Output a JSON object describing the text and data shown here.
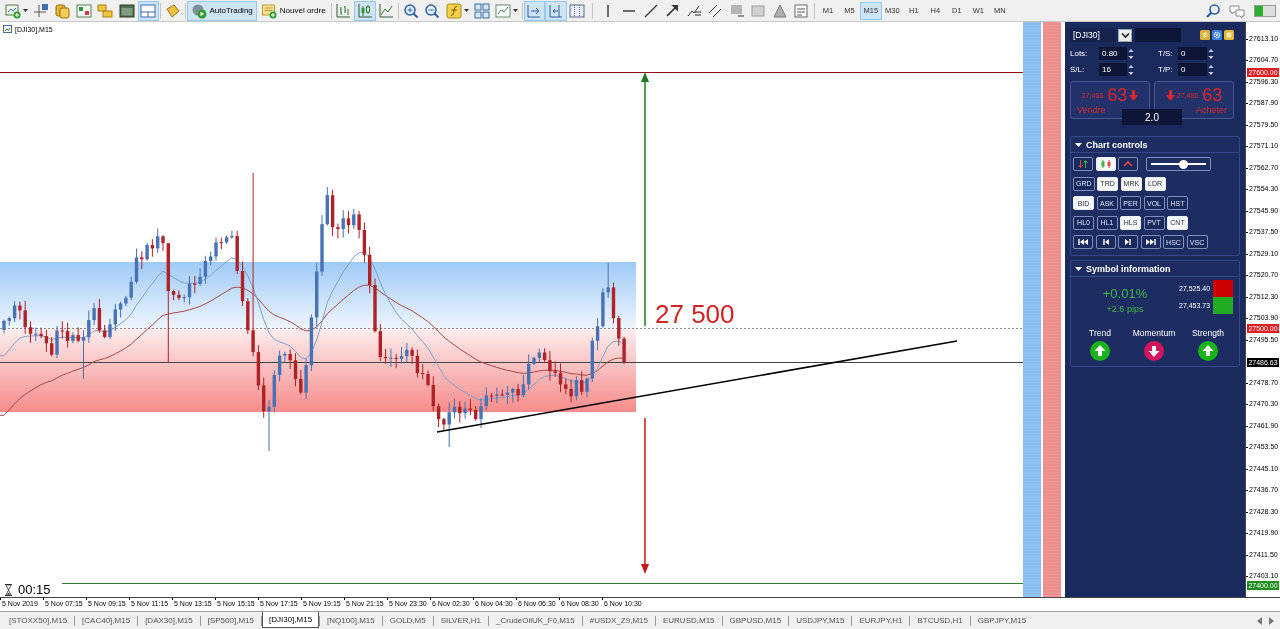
{
  "toolbar": {
    "groups": [
      [
        {
          "kind": "icon",
          "selected": false
        },
        {
          "kind": "icon",
          "selected": false
        },
        {
          "kind": "icon",
          "selected": false
        },
        {
          "kind": "icon",
          "selected": false
        },
        {
          "kind": "icon",
          "selected": false
        },
        {
          "kind": "icon",
          "selected": false
        },
        {
          "kind": "icon",
          "selected": true
        }
      ],
      [
        {
          "kind": "icon",
          "selected": false
        }
      ],
      [
        {
          "kind": "button",
          "label": "AutoTrading",
          "selected": true
        },
        {
          "kind": "button",
          "label": "Nouvel ordre",
          "selected": false
        }
      ],
      [
        {
          "kind": "icon",
          "selected": false
        },
        {
          "kind": "icon",
          "selected": true
        },
        {
          "kind": "icon",
          "selected": false
        }
      ],
      [
        {
          "kind": "icon",
          "selected": false
        },
        {
          "kind": "icon",
          "selected": false
        },
        {
          "kind": "icon",
          "selected": false
        },
        {
          "kind": "icon",
          "selected": false
        },
        {
          "kind": "icon",
          "selected": false
        }
      ],
      [
        {
          "kind": "icon",
          "selected": true
        },
        {
          "kind": "icon",
          "selected": true
        },
        {
          "kind": "icon",
          "selected": false
        }
      ],
      [
        {
          "kind": "icon",
          "selected": false
        },
        {
          "kind": "icon",
          "selected": false
        },
        {
          "kind": "icon",
          "selected": false
        },
        {
          "kind": "icon",
          "selected": false
        },
        {
          "kind": "icon",
          "selected": false
        },
        {
          "kind": "icon",
          "selected": false
        },
        {
          "kind": "icon",
          "selected": false
        },
        {
          "kind": "icon",
          "selected": false
        },
        {
          "kind": "icon",
          "selected": false
        },
        {
          "kind": "icon",
          "selected": false
        }
      ],
      [
        {
          "kind": "timeframe",
          "label": "M1",
          "selected": false
        },
        {
          "kind": "timeframe",
          "label": "M5",
          "selected": false
        },
        {
          "kind": "timeframe",
          "label": "M15",
          "selected": true
        },
        {
          "kind": "timeframe",
          "label": "M30",
          "selected": false
        },
        {
          "kind": "timeframe",
          "label": "H1",
          "selected": false
        },
        {
          "kind": "timeframe",
          "label": "H4",
          "selected": false
        },
        {
          "kind": "timeframe",
          "label": "D1",
          "selected": false
        },
        {
          "kind": "timeframe",
          "label": "W1",
          "selected": false
        },
        {
          "kind": "timeframe",
          "label": "MN",
          "selected": false
        }
      ]
    ]
  },
  "chart": {
    "title": "[DJI30],M15",
    "annotation": "27 500",
    "timer": "00:15",
    "strips": [
      {
        "color": "#90c4f4"
      },
      {
        "color": "#f39494"
      }
    ],
    "price_axis": {
      "ticks": [
        "27613.10",
        "27604.70",
        "27596.30",
        "27587.90",
        "27579.50",
        "27571.10",
        "27562.70",
        "27554.30",
        "27545.90",
        "27537.50",
        "27529.10",
        "27520.70",
        "27512.30",
        "27503.90",
        "27495.50",
        "27478.70",
        "27470.30",
        "27461.90",
        "27453.50",
        "27445.10",
        "27436.70",
        "27428.30",
        "27419.90",
        "27411.50",
        "27403.10"
      ],
      "tags": [
        {
          "text": "27600.00",
          "color": "#e01e1e"
        },
        {
          "text": "27500.00",
          "color": "#e01e1e"
        },
        {
          "text": "27486.63",
          "color": "#000000"
        },
        {
          "text": "27400.00",
          "color": "#1e8c1e"
        }
      ]
    },
    "time_axis": {
      "labels": [
        "5 Nov 2019",
        "5 Nov 07:15",
        "5 Nov 09:15",
        "5 Nov 11:15",
        "5 Nov 13:15",
        "5 Nov 15:15",
        "5 Nov 17:15",
        "5 Nov 19:15",
        "5 Nov 21:15",
        "5 Nov 23:30",
        "6 Nov 02:30",
        "6 Nov 04:30",
        "6 Nov 06:30",
        "6 Nov 08:30",
        "6 Nov 10:30"
      ]
    }
  },
  "panel": {
    "symbol": "[DJI30]",
    "rows": [
      [
        {
          "label": "Lots:",
          "value": "0.80"
        },
        {
          "label": "T/S:",
          "value": "0"
        }
      ],
      [
        {
          "label": "S/L:",
          "value": "16"
        },
        {
          "label": "T/P:",
          "value": "0"
        }
      ]
    ],
    "sell": {
      "price": "27,486.",
      "pips": "63",
      "label": "Vendre",
      "falling": true
    },
    "buy": {
      "price": "27,486.",
      "pips": "63",
      "label": "Acheter",
      "falling": true
    },
    "volume": "2.0",
    "chart_controls": {
      "title": "Chart controls",
      "rows": [
        [
          {
            "kind": "icon",
            "selected": false
          },
          {
            "kind": "icon",
            "selected": true
          },
          {
            "kind": "icon",
            "selected": false
          },
          {
            "kind": "slider",
            "level": 0.6
          }
        ],
        [
          {
            "kind": "text",
            "label": "GRD",
            "selected": false
          },
          {
            "kind": "text",
            "label": "TRD",
            "selected": true
          },
          {
            "kind": "text",
            "label": "MRK",
            "selected": true
          },
          {
            "kind": "text",
            "label": "LDR",
            "selected": true
          }
        ],
        [
          {
            "kind": "text",
            "label": "BID",
            "selected": true
          },
          {
            "kind": "text",
            "label": "ASK",
            "selected": false
          },
          {
            "kind": "text",
            "label": "PER",
            "selected": false
          },
          {
            "kind": "text",
            "label": "VOL",
            "selected": false
          },
          {
            "kind": "text",
            "label": "HST",
            "selected": false
          }
        ],
        [
          {
            "kind": "text",
            "label": "HL0",
            "selected": false
          },
          {
            "kind": "text",
            "label": "HL1",
            "selected": false
          },
          {
            "kind": "text",
            "label": "HLS",
            "selected": true
          },
          {
            "kind": "text",
            "label": "PVT",
            "selected": false
          },
          {
            "kind": "text",
            "label": "CNT",
            "selected": true
          }
        ],
        [
          {
            "kind": "icon",
            "selected": false
          },
          {
            "kind": "icon",
            "selected": false
          },
          {
            "kind": "icon",
            "selected": false
          },
          {
            "kind": "icon",
            "selected": false
          },
          {
            "kind": "text",
            "label": "HSC",
            "selected": false
          },
          {
            "kind": "text",
            "label": "VSC",
            "selected": false
          }
        ]
      ]
    },
    "symbol_info": {
      "title": "Symbol information",
      "change": "+0.01%",
      "pips": "+2.6 pips",
      "levels": [
        {
          "value": "27,525.40",
          "color": "#cc0000"
        },
        {
          "value": "27,453.73",
          "color": "#22aa22"
        }
      ],
      "signals": [
        {
          "label": "Trend",
          "rising": true
        },
        {
          "label": "Momentum",
          "rising": false
        },
        {
          "label": "Strength",
          "rising": true
        }
      ]
    }
  },
  "tabs": [
    {
      "label": "[STOXX50],M15",
      "selected": false
    },
    {
      "label": "[CAC40],M15",
      "selected": false
    },
    {
      "label": "[DAX30],M15",
      "selected": false
    },
    {
      "label": "[SP500],M15",
      "selected": false
    },
    {
      "label": "[DJI30],M15",
      "selected": true
    },
    {
      "label": "[NQ100],M15",
      "selected": false
    },
    {
      "label": "GOLD,M5",
      "selected": false
    },
    {
      "label": "SILVER,H1",
      "selected": false
    },
    {
      "label": "_CrudeOilUK_F0,M15",
      "selected": false
    },
    {
      "label": "#USDX_Z9,M15",
      "selected": false
    },
    {
      "label": "EURUSD,M15",
      "selected": false
    },
    {
      "label": "GBPUSD,M15",
      "selected": false
    },
    {
      "label": "USDJPY,M15",
      "selected": false
    },
    {
      "label": "EURJPY,H1",
      "selected": false
    },
    {
      "label": "BTCUSD,H1",
      "selected": false
    },
    {
      "label": "GBPJPY,M15",
      "selected": false
    }
  ]
}
